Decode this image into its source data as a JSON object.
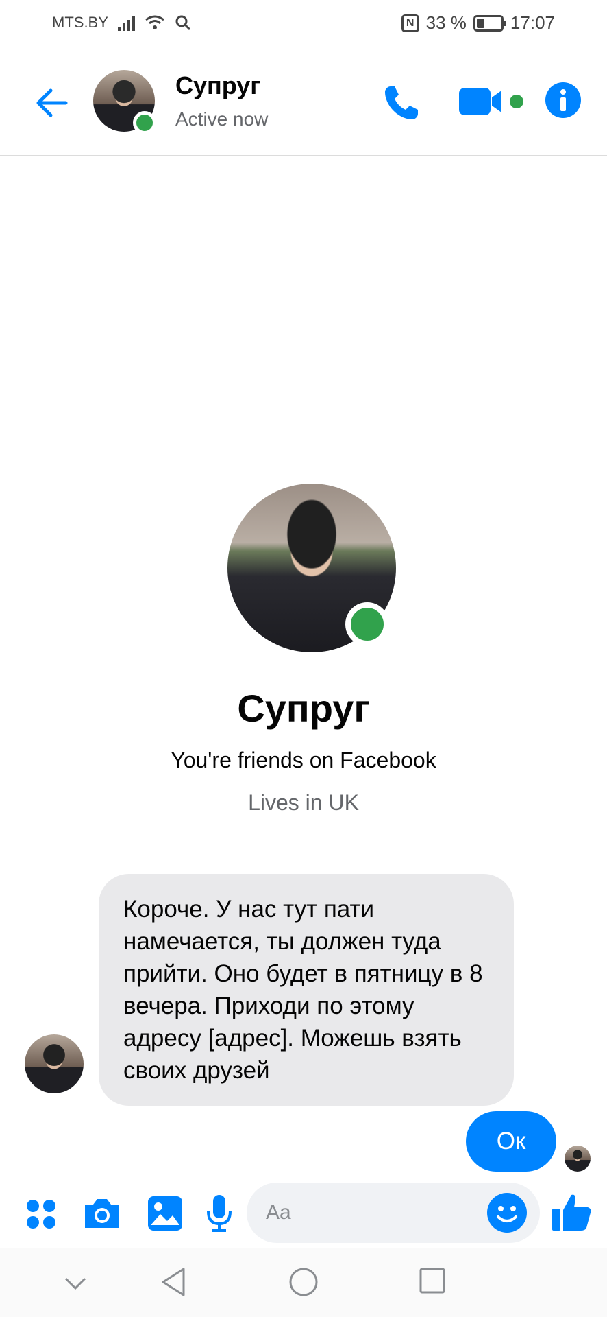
{
  "statusbar": {
    "carrier": "MTS.BY",
    "battery_percent": "33 %",
    "battery_level": 0.33,
    "time": "17:07"
  },
  "header": {
    "contact_name": "Супруг",
    "status": "Active now"
  },
  "profile": {
    "name": "Супруг",
    "friends_text": "You're friends on Facebook",
    "lives_text": "Lives in UK"
  },
  "messages": [
    {
      "from": "contact",
      "text": "Короче. У нас тут пати намечается, ты должен туда прийти. Оно будет в пятницу в 8 вечера. Приходи по этому адресу [адрес]. Можешь взять своих друзей"
    },
    {
      "from": "me",
      "text": "Ок"
    }
  ],
  "composer": {
    "placeholder": "Aa"
  },
  "colors": {
    "accent": "#0084ff",
    "online": "#31a24c",
    "incoming_bubble": "#e9e9eb"
  }
}
